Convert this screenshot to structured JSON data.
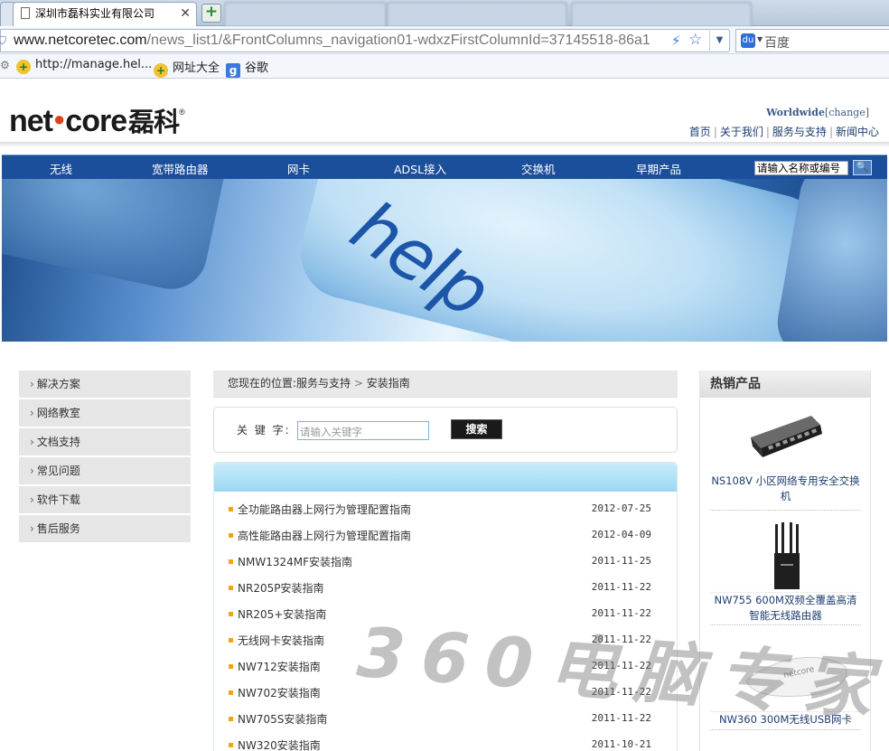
{
  "browser": {
    "active_tab_title": "深圳市磊科实业有限公司",
    "url_domain": "www.netcoretec.com",
    "url_path": "/news_list1/&FrontColumns_navigation01-wdxzFirstColumnId=37145518-86a1",
    "search_engine": "百度",
    "bookmarks": [
      {
        "label": "http://manage.hel...",
        "icon": "plus-badge-icon"
      },
      {
        "label": "网址大全",
        "icon": "plus-badge-icon"
      },
      {
        "label": "谷歌",
        "icon": "google-icon"
      }
    ]
  },
  "header": {
    "logo_text": "net",
    "logo_text2": "core",
    "logo_cn": "磊科",
    "logo_mark": "®",
    "worldwide": "Worldwide",
    "change": "[change]",
    "top_links": [
      "首页",
      "关于我们",
      "服务与支持",
      "新闻中心"
    ]
  },
  "nav": {
    "items": [
      "无线",
      "宽带路由器",
      "网卡",
      "ADSL接入",
      "交换机",
      "早期产品"
    ],
    "search_placeholder": "请输入名称或编号"
  },
  "banner": {
    "text": "help"
  },
  "left_menu": [
    "解决方案",
    "网络教室",
    "文档支持",
    "常见问题",
    "软件下载",
    "售后服务"
  ],
  "breadcrumb": {
    "prefix": "您现在的位置:",
    "level1": "服务与支持",
    "sep": ">",
    "level2": "安装指南"
  },
  "search": {
    "label": "关 键 字:",
    "placeholder": "请输入关键字",
    "button": "搜索"
  },
  "news": [
    {
      "title": "全功能路由器上网行为管理配置指南",
      "date": "2012-07-25"
    },
    {
      "title": "高性能路由器上网行为管理配置指南",
      "date": "2012-04-09"
    },
    {
      "title": "NMW1324MF安装指南",
      "date": "2011-11-25"
    },
    {
      "title": "NR205P安装指南",
      "date": "2011-11-22"
    },
    {
      "title": "NR205+安装指南",
      "date": "2011-11-22"
    },
    {
      "title": "无线网卡安装指南",
      "date": "2011-11-22"
    },
    {
      "title": "NW712安装指南",
      "date": "2011-11-22"
    },
    {
      "title": "NW702安装指南",
      "date": "2011-11-22"
    },
    {
      "title": "NW705S安装指南",
      "date": "2011-11-22"
    },
    {
      "title": "NW320安装指南",
      "date": "2011-10-21"
    }
  ],
  "hot": {
    "title": "热销产品",
    "products": [
      {
        "caption": "NS108V 小区网络专用安全交换机"
      },
      {
        "caption": "NW755 600M双频全覆盖高清智能无线路由器"
      },
      {
        "caption": "NW360 300M无线USB网卡"
      }
    ]
  },
  "watermark": "360电脑专家"
}
